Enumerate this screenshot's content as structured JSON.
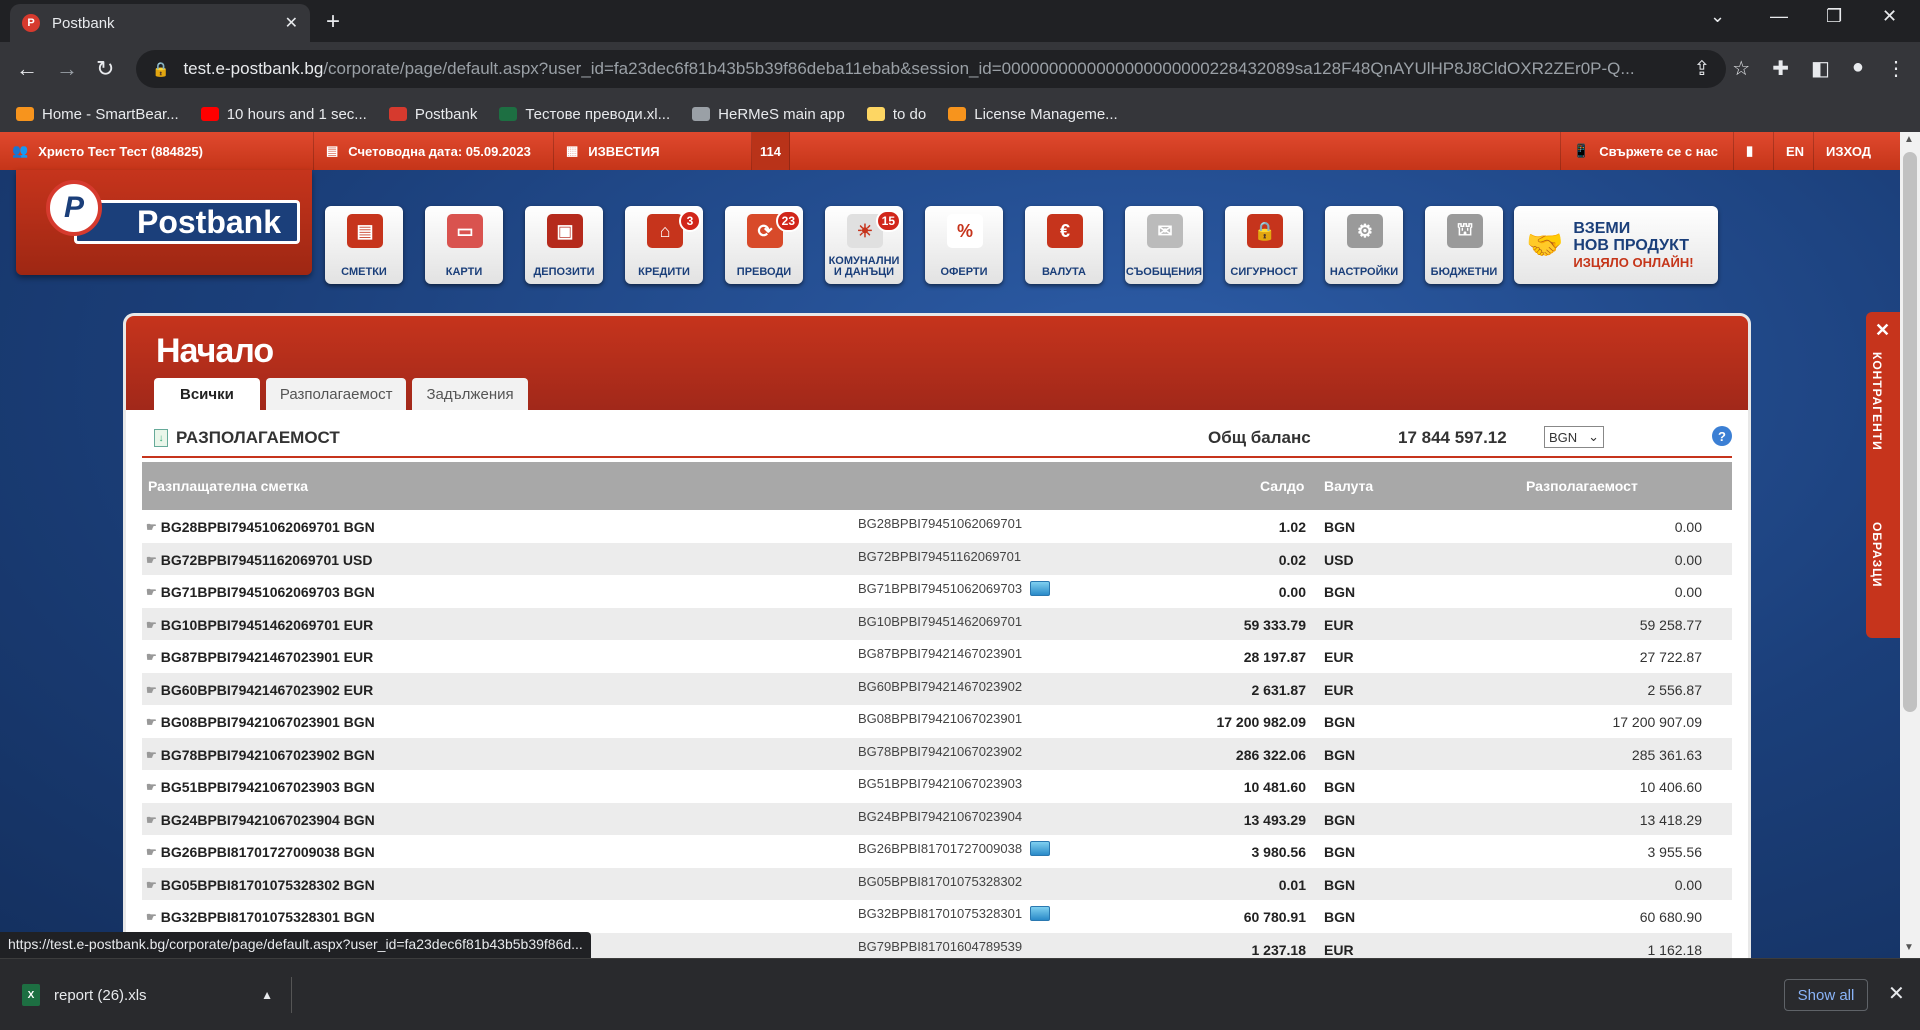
{
  "browser": {
    "tab_title": "Postbank",
    "tab_close": "✕",
    "new_tab": "+",
    "url_host": "test.e-postbank.bg",
    "url_path": "/corporate/page/default.aspx?user_id=fa23dec6f81b43b5b39f86deba11ebab&session_id=0000000000000000000000228432089sa128F48QnAYUlHP8J8CldOXR2ZEr0P-Q...",
    "bookmarks": [
      {
        "label": "Home - SmartBear...",
        "color": "#f7941d"
      },
      {
        "label": "10 hours and 1 sec...",
        "color": "#ff0000"
      },
      {
        "label": "Postbank",
        "color": "#d63a2e"
      },
      {
        "label": "Тестове преводи.xl...",
        "color": "#1d6f42"
      },
      {
        "label": "HeRMeS main app",
        "color": "#9aa0a6"
      },
      {
        "label": "to do",
        "color": "#fdd663"
      },
      {
        "label": "License Manageme...",
        "color": "#f7941d"
      }
    ],
    "status_url": "https://test.e-postbank.bg/corporate/page/default.aspx?user_id=fa23dec6f81b43b5b39f86d...",
    "download": {
      "filename": "report (26).xls",
      "show_all": "Show all"
    }
  },
  "topbar": {
    "user": "Христо Тест Тест (884825)",
    "accounting_date": "Счетоводна дата: 05.09.2023",
    "news": "ИЗВЕСТИЯ",
    "news_count": "114",
    "contact": "Свържете се с нас",
    "lang": "EN",
    "logout": "ИЗХОД"
  },
  "logo": {
    "text": "Postbank",
    "letter": "P"
  },
  "tiles": [
    {
      "label": "СМЕТКИ",
      "icon": "accounts-icon",
      "color": "#c6341c",
      "badge": ""
    },
    {
      "label": "КАРТИ",
      "icon": "cards-icon",
      "color": "#d9534f",
      "badge": ""
    },
    {
      "label": "ДЕПОЗИТИ",
      "icon": "safe-icon",
      "color": "#b52a1c",
      "badge": ""
    },
    {
      "label": "КРЕДИТИ",
      "icon": "house-icon",
      "color": "#c6341c",
      "badge": "3"
    },
    {
      "label": "ПРЕВОДИ",
      "icon": "transfer-icon",
      "color": "#d84a2a",
      "badge": "23"
    },
    {
      "label": "КОМУНАЛНИ И ДАНЪЦИ",
      "icon": "bulb-icon",
      "color": "#e0e0e0",
      "badge": "15"
    },
    {
      "label": "ОФЕРТИ",
      "icon": "percent-icon",
      "color": "#ffffff",
      "badge": ""
    },
    {
      "label": "ВАЛУТА",
      "icon": "euro-icon",
      "color": "#c6341c",
      "badge": ""
    },
    {
      "label": "СЪОБЩЕНИЯ",
      "icon": "envelope-icon",
      "color": "#bbbbbb",
      "badge": ""
    },
    {
      "label": "СИГУРНОСТ",
      "icon": "lock-icon",
      "color": "#c6341c",
      "badge": ""
    },
    {
      "label": "НАСТРОЙКИ",
      "icon": "gear-icon",
      "color": "#9a9a9a",
      "badge": ""
    },
    {
      "label": "БЮДЖЕТНИ",
      "icon": "bank-icon",
      "color": "#9a9a9a",
      "badge": ""
    }
  ],
  "promo": {
    "line1": "ВЗЕМИ",
    "line2": "НОВ ПРОДУКТ",
    "line3": "ИЗЦЯЛО ОНЛАЙН!"
  },
  "panel": {
    "title": "Начало",
    "tabs": [
      "Всички",
      "Разполагаемост",
      "Задължения"
    ],
    "section_title": "РАЗПОЛАГАЕМОСТ",
    "total_label": "Общ баланс",
    "total_value": "17 844 597.12",
    "currency": "BGN"
  },
  "table": {
    "headers": {
      "account": "Разплащателна сметка",
      "balance": "Салдо",
      "currency": "Валута",
      "available": "Разполагаемост"
    },
    "rows": [
      {
        "account": "BG28BPBI79451062069701 BGN",
        "iban": "BG28BPBI79451062069701",
        "card": false,
        "balance": "1.02",
        "currency": "BGN",
        "available": "0.00"
      },
      {
        "account": "BG72BPBI79451162069701 USD",
        "iban": "BG72BPBI79451162069701",
        "card": false,
        "balance": "0.02",
        "currency": "USD",
        "available": "0.00"
      },
      {
        "account": "BG71BPBI79451062069703 BGN",
        "iban": "BG71BPBI79451062069703",
        "card": true,
        "balance": "0.00",
        "currency": "BGN",
        "available": "0.00"
      },
      {
        "account": "BG10BPBI79451462069701 EUR",
        "iban": "BG10BPBI79451462069701",
        "card": false,
        "balance": "59 333.79",
        "currency": "EUR",
        "available": "59 258.77"
      },
      {
        "account": "BG87BPBI79421467023901 EUR",
        "iban": "BG87BPBI79421467023901",
        "card": false,
        "balance": "28 197.87",
        "currency": "EUR",
        "available": "27 722.87"
      },
      {
        "account": "BG60BPBI79421467023902 EUR",
        "iban": "BG60BPBI79421467023902",
        "card": false,
        "balance": "2 631.87",
        "currency": "EUR",
        "available": "2 556.87"
      },
      {
        "account": "BG08BPBI79421067023901 BGN",
        "iban": "BG08BPBI79421067023901",
        "card": false,
        "balance": "17 200 982.09",
        "currency": "BGN",
        "available": "17 200 907.09"
      },
      {
        "account": "BG78BPBI79421067023902 BGN",
        "iban": "BG78BPBI79421067023902",
        "card": false,
        "balance": "286 322.06",
        "currency": "BGN",
        "available": "285 361.63"
      },
      {
        "account": "BG51BPBI79421067023903 BGN",
        "iban": "BG51BPBI79421067023903",
        "card": false,
        "balance": "10 481.60",
        "currency": "BGN",
        "available": "10 406.60"
      },
      {
        "account": "BG24BPBI79421067023904 BGN",
        "iban": "BG24BPBI79421067023904",
        "card": false,
        "balance": "13 493.29",
        "currency": "BGN",
        "available": "13 418.29"
      },
      {
        "account": "BG26BPBI81701727009038 BGN",
        "iban": "BG26BPBI81701727009038",
        "card": true,
        "balance": "3 980.56",
        "currency": "BGN",
        "available": "3 955.56"
      },
      {
        "account": "BG05BPBI81701075328302 BGN",
        "iban": "BG05BPBI81701075328302",
        "card": false,
        "balance": "0.01",
        "currency": "BGN",
        "available": "0.00"
      },
      {
        "account": "BG32BPBI81701075328301 BGN",
        "iban": "BG32BPBI81701075328301",
        "card": true,
        "balance": "60 780.91",
        "currency": "BGN",
        "available": "60 680.90"
      },
      {
        "account": "",
        "iban": "BG79BPBI81701604789539",
        "card": false,
        "balance": "1 237.18",
        "currency": "EUR",
        "available": "1 162.18"
      }
    ]
  },
  "sidetabs": {
    "contacts": "КОНТРАГЕНТИ",
    "templates": "ОБРАЗЦИ"
  }
}
